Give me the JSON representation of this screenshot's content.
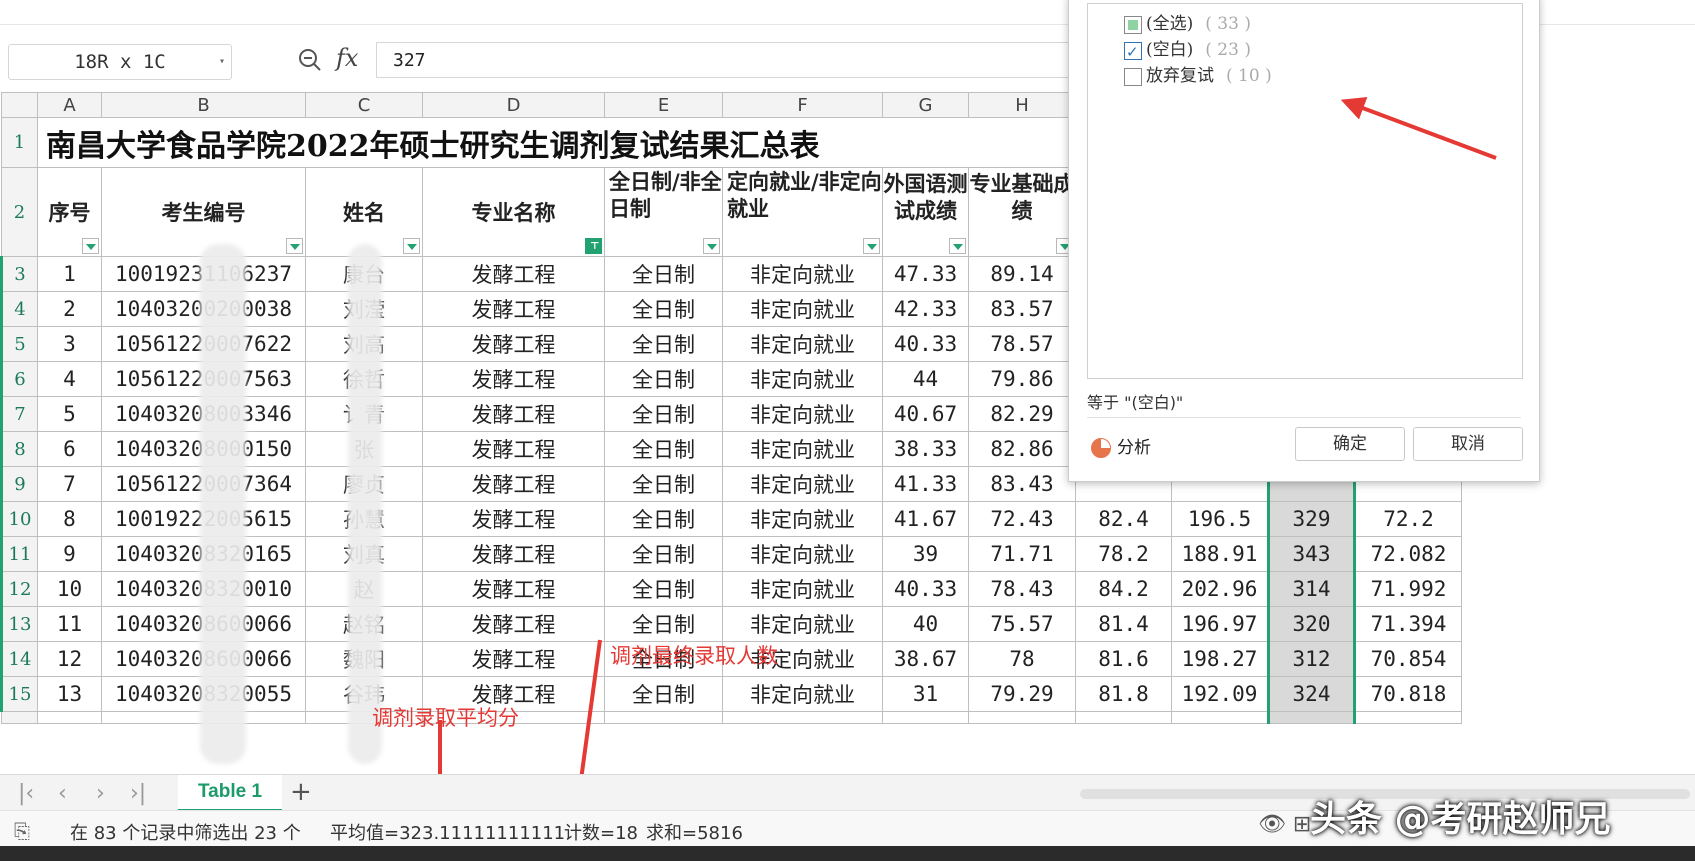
{
  "formula": {
    "name_box": "18R x 1C",
    "fx": "fx",
    "value": "327"
  },
  "columns": [
    "A",
    "B",
    "C",
    "D",
    "E",
    "F",
    "G",
    "H"
  ],
  "title": "南昌大学食品学院2022年硕士研究生调剂复试结果汇总表",
  "headers": {
    "A": "序号",
    "B": "考生编号",
    "C": "姓名",
    "D": "专业名称",
    "E": "全日制/非全日制",
    "F": "定向就业/非定向就业",
    "G": "外国语测试成绩",
    "H": "专业基础成绩"
  },
  "rows": [
    {
      "rn": "3",
      "a": "1",
      "b": "10019231106237",
      "c": "康台",
      "d": "发酵工程",
      "e": "全日制",
      "f": "非定向就业",
      "g": "47.33",
      "h": "89.14",
      "i": "",
      "j": "",
      "k": "",
      "l": ""
    },
    {
      "rn": "4",
      "a": "2",
      "b": "10403200200038",
      "c": "刘滢",
      "d": "发酵工程",
      "e": "全日制",
      "f": "非定向就业",
      "g": "42.33",
      "h": "83.57",
      "i": "",
      "j": "",
      "k": "",
      "l": ""
    },
    {
      "rn": "5",
      "a": "3",
      "b": "10561220007622",
      "c": "刘高",
      "d": "发酵工程",
      "e": "全日制",
      "f": "非定向就业",
      "g": "40.33",
      "h": "78.57",
      "i": "",
      "j": "",
      "k": "",
      "l": ""
    },
    {
      "rn": "6",
      "a": "4",
      "b": "10561220007563",
      "c": "徐哲",
      "d": "发酵工程",
      "e": "全日制",
      "f": "非定向就业",
      "g": "44",
      "h": "79.86",
      "i": "",
      "j": "",
      "k": "",
      "l": ""
    },
    {
      "rn": "7",
      "a": "5",
      "b": "10403208003346",
      "c": "讠青",
      "d": "发酵工程",
      "e": "全日制",
      "f": "非定向就业",
      "g": "40.67",
      "h": "82.29",
      "i": "",
      "j": "",
      "k": "",
      "l": ""
    },
    {
      "rn": "8",
      "a": "6",
      "b": "10403208000150",
      "c": "张",
      "d": "发酵工程",
      "e": "全日制",
      "f": "非定向就业",
      "g": "38.33",
      "h": "82.86",
      "i": "",
      "j": "",
      "k": "",
      "l": ""
    },
    {
      "rn": "9",
      "a": "7",
      "b": "10561220007364",
      "c": "廖贞",
      "d": "发酵工程",
      "e": "全日制",
      "f": "非定向就业",
      "g": "41.33",
      "h": "83.43",
      "i": "",
      "j": "",
      "k": "",
      "l": ""
    },
    {
      "rn": "10",
      "a": "8",
      "b": "10019222005615",
      "c": "孙慧",
      "d": "发酵工程",
      "e": "全日制",
      "f": "非定向就业",
      "g": "41.67",
      "h": "72.43",
      "i": "82.4",
      "j": "196.5",
      "k": "329",
      "l": "72.2"
    },
    {
      "rn": "11",
      "a": "9",
      "b": "10403208320165",
      "c": "刘真",
      "d": "发酵工程",
      "e": "全日制",
      "f": "非定向就业",
      "g": "39",
      "h": "71.71",
      "i": "78.2",
      "j": "188.91",
      "k": "343",
      "l": "72.082"
    },
    {
      "rn": "12",
      "a": "10",
      "b": "10403208320010",
      "c": "赵",
      "d": "发酵工程",
      "e": "全日制",
      "f": "非定向就业",
      "g": "40.33",
      "h": "78.43",
      "i": "84.2",
      "j": "202.96",
      "k": "314",
      "l": "71.992"
    },
    {
      "rn": "13",
      "a": "11",
      "b": "10403208600066",
      "c": "赵铭",
      "d": "发酵工程",
      "e": "全日制",
      "f": "非定向就业",
      "g": "40",
      "h": "75.57",
      "i": "81.4",
      "j": "196.97",
      "k": "320",
      "l": "71.394"
    },
    {
      "rn": "14",
      "a": "12",
      "b": "10403208600066",
      "c": "魏阳",
      "d": "发酵工程",
      "e": "全日制",
      "f": "非定向就业",
      "g": "38.67",
      "h": "78",
      "i": "81.6",
      "j": "198.27",
      "k": "312",
      "l": "70.854"
    },
    {
      "rn": "15",
      "a": "13",
      "b": "10403208320055",
      "c": "谷玮",
      "d": "发酵工程",
      "e": "全日制",
      "f": "非定向就业",
      "g": "31",
      "h": "79.29",
      "i": "81.8",
      "j": "192.09",
      "k": "324",
      "l": "70.818"
    }
  ],
  "filter_panel": {
    "items": [
      {
        "label": "(全选)",
        "count": "( 33 )"
      },
      {
        "label": "(空白)",
        "count": "( 23 )"
      },
      {
        "label": "放弃复试",
        "count": "( 10 )"
      }
    ],
    "condition": "等于 \"(空白)\"",
    "analyze": "分析",
    "ok": "确定",
    "cancel": "取消"
  },
  "annotations": {
    "final_count": "调剂最终录取人数",
    "avg_score": "调剂录取平均分"
  },
  "tabs": {
    "active": "Table 1",
    "add": "+"
  },
  "status": {
    "filter_info": "在 83 个记录中筛选出 23 个",
    "average": "平均值=323.11111111111",
    "count": "计数=18",
    "sum": "求和=5816"
  },
  "watermark": "头条 @考研赵师兄"
}
